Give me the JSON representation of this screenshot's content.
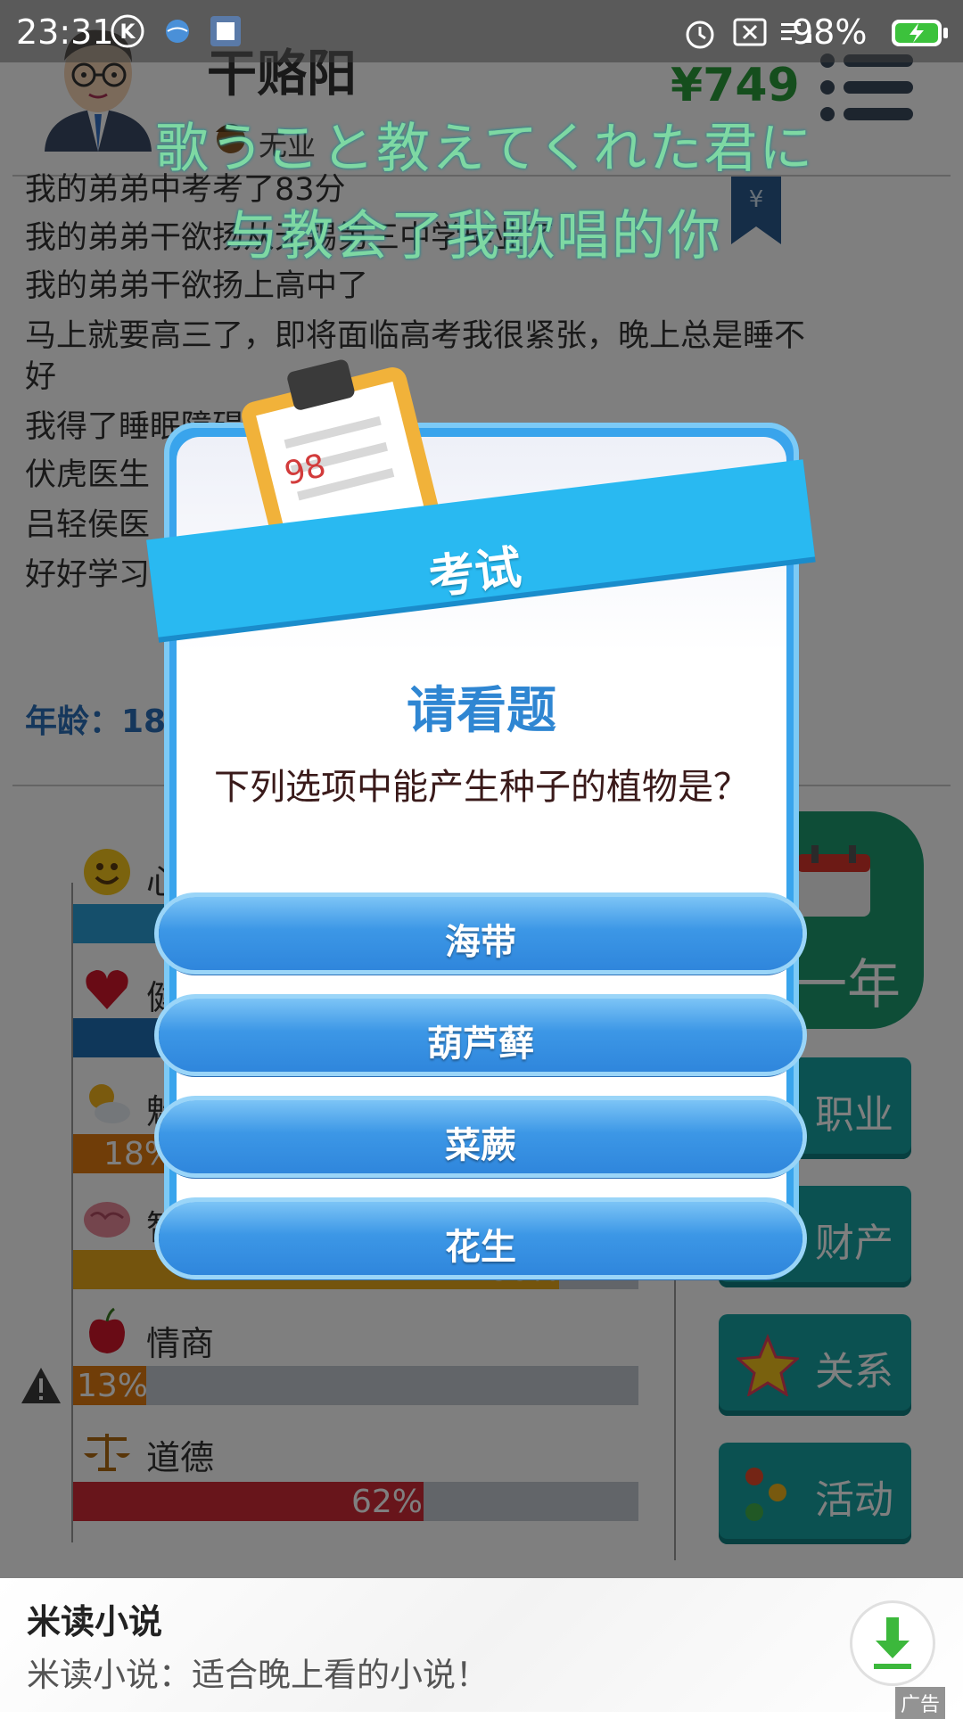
{
  "status_bar": {
    "time": "23:31",
    "battery": "98%"
  },
  "header": {
    "player_name": "干赂阳",
    "money": "¥749",
    "career": "无业"
  },
  "lyrics": {
    "line1": "歌うこと教えてくれた君に",
    "line2": "与教会了我歌唱的你"
  },
  "log": [
    "我的弟弟中考考了83分",
    "我的弟弟干欲扬从无锡第三中学毕业了",
    "我的弟弟干欲扬上高中了",
    "马上就要高三了，即将面临高考我很紧张，晚上总是睡不",
    "好",
    "我得了睡眠障碍",
    "伏虎医生",
    "吕轻侯医",
    "好好学习"
  ],
  "age": {
    "label": "年龄：18"
  },
  "stats": [
    {
      "label": "心情",
      "percent": 100,
      "color": "#2a9fd6",
      "pct_text": ""
    },
    {
      "label": "健康",
      "percent": 100,
      "color": "#1f6fb5",
      "pct_text": ""
    },
    {
      "label": "魅力",
      "percent": 18,
      "color": "#e07a10",
      "pct_text": "18%"
    },
    {
      "label": "智力",
      "percent": 86,
      "color": "#e8a81a",
      "pct_text": "86%"
    },
    {
      "label": "情商",
      "percent": 13,
      "color": "#e07a10",
      "pct_text": "13%"
    },
    {
      "label": "道德",
      "percent": 62,
      "color": "#d02b36",
      "pct_text": "62%"
    }
  ],
  "side_buttons": {
    "next_year": "一年",
    "career": "职业",
    "assets": "财产",
    "relations": "关系",
    "activities": "活动"
  },
  "exam": {
    "ribbon": "考试",
    "title": "请看题",
    "question": "下列选项中能产生种子的植物是？",
    "options": [
      "海带",
      "葫芦藓",
      "菜蕨",
      "花生"
    ]
  },
  "ad": {
    "title": "米读小说",
    "description": "米读小说：适合晚上看的小说！",
    "tag": "广告"
  }
}
